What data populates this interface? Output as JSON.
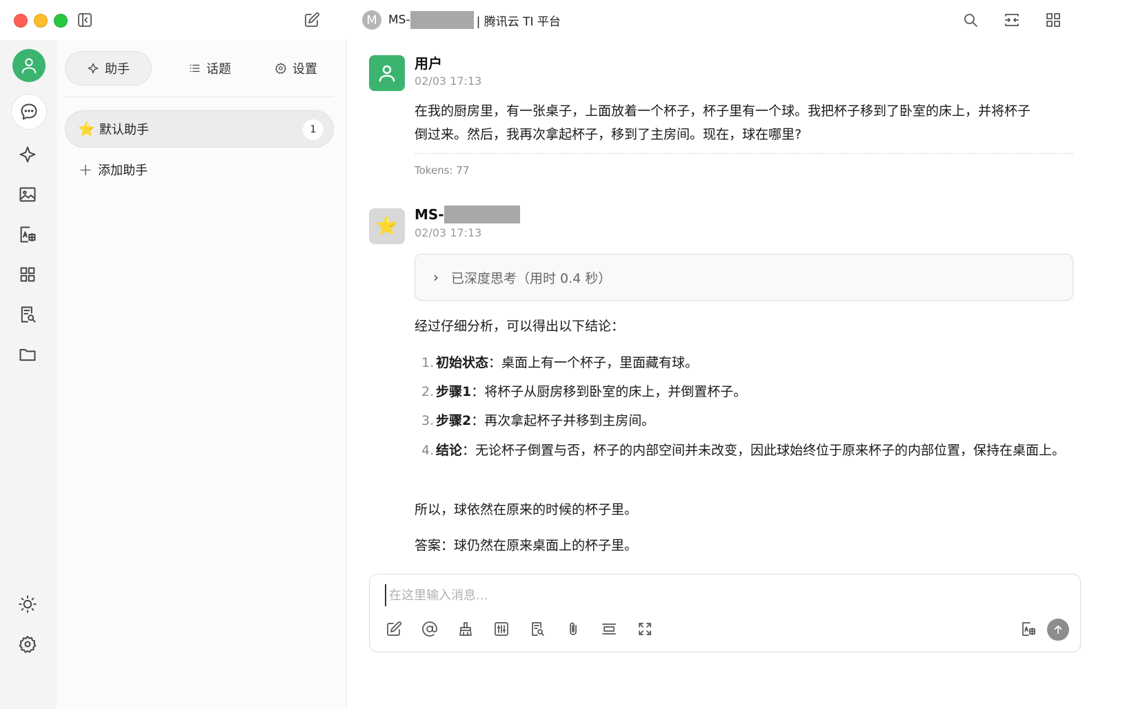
{
  "titlebar": {
    "model_initial": "M",
    "model_prefix": "MS-",
    "platform": "| 腾讯云 TI 平台"
  },
  "panel": {
    "tabs": [
      {
        "label": "助手",
        "icon": "sparkle-icon"
      },
      {
        "label": "话题",
        "icon": "list-icon"
      },
      {
        "label": "设置",
        "icon": "gear-icon"
      }
    ],
    "assistant": {
      "name": "默认助手",
      "icon": "star-emoji",
      "count": "1"
    },
    "add_label": "添加助手"
  },
  "chat": {
    "user_message": {
      "name": "用户",
      "time": "02/03 17:13",
      "text_line1": "在我的厨房里，有一张桌子，上面放着一个杯子，杯子里有一个球。我把杯子移到了卧室的床上，并将杯子",
      "text_line2": "倒过来。然后，我再次拿起杯子，移到了主房间。现在，球在哪里?",
      "tokens": "Tokens: 77"
    },
    "bot_message": {
      "name_prefix": "MS-",
      "time": "02/03 17:13",
      "thinking": "已深度思考（用时 0.4 秒）",
      "intro": "经过仔细分析，可以得出以下结论：",
      "items": [
        {
          "num": "1.",
          "title": "初始状态",
          "text": "：桌面上有一个杯子，里面藏有球。"
        },
        {
          "num": "2.",
          "title": "步骤1",
          "text": "：将杯子从厨房移到卧室的床上，并倒置杯子。"
        },
        {
          "num": "3.",
          "title": "步骤2",
          "text": "：再次拿起杯子并移到主房间。"
        },
        {
          "num": "4.",
          "title": "结论",
          "text": "：无论杯子倒置与否，杯子的内部空间并未改变，因此球始终位于原来杯子的内部位置，保持在桌面上。"
        }
      ],
      "so": "所以，球依然在原来的时候的杯子里。",
      "answer": "答案：球仍然在原来桌面上的杯子里。"
    },
    "input": {
      "placeholder": "在这里输入消息..."
    }
  },
  "colors": {
    "accent_green": "#3bb46f",
    "send_button": "#8d8d8d"
  }
}
